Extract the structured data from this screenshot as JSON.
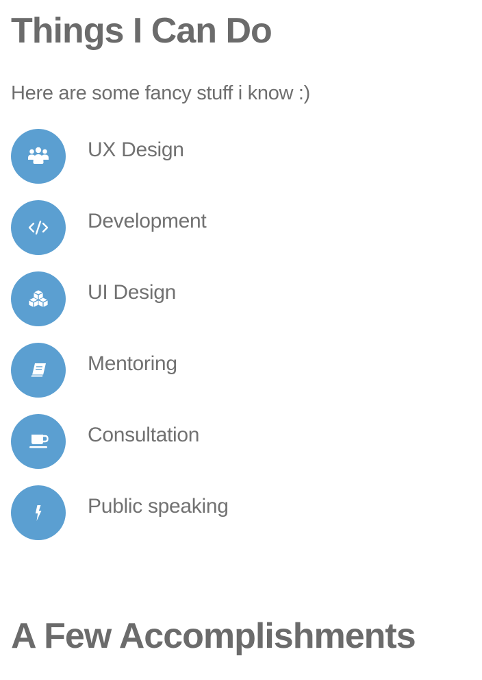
{
  "skills_section": {
    "title": "Things I Can Do",
    "intro": "Here are some fancy stuff i know :)",
    "items": [
      {
        "label": "UX Design",
        "icon": "users-icon"
      },
      {
        "label": "Development",
        "icon": "code-icon"
      },
      {
        "label": "UI Design",
        "icon": "cubes-icon"
      },
      {
        "label": "Mentoring",
        "icon": "book-icon"
      },
      {
        "label": "Consultation",
        "icon": "coffee-icon"
      },
      {
        "label": "Public speaking",
        "icon": "bolt-icon"
      }
    ]
  },
  "accomplishments_section": {
    "title": "A Few Accomplishments"
  },
  "colors": {
    "accent": "#5b9fd1",
    "heading": "#6b6b6b",
    "text": "#717171",
    "background": "#ffffff"
  }
}
